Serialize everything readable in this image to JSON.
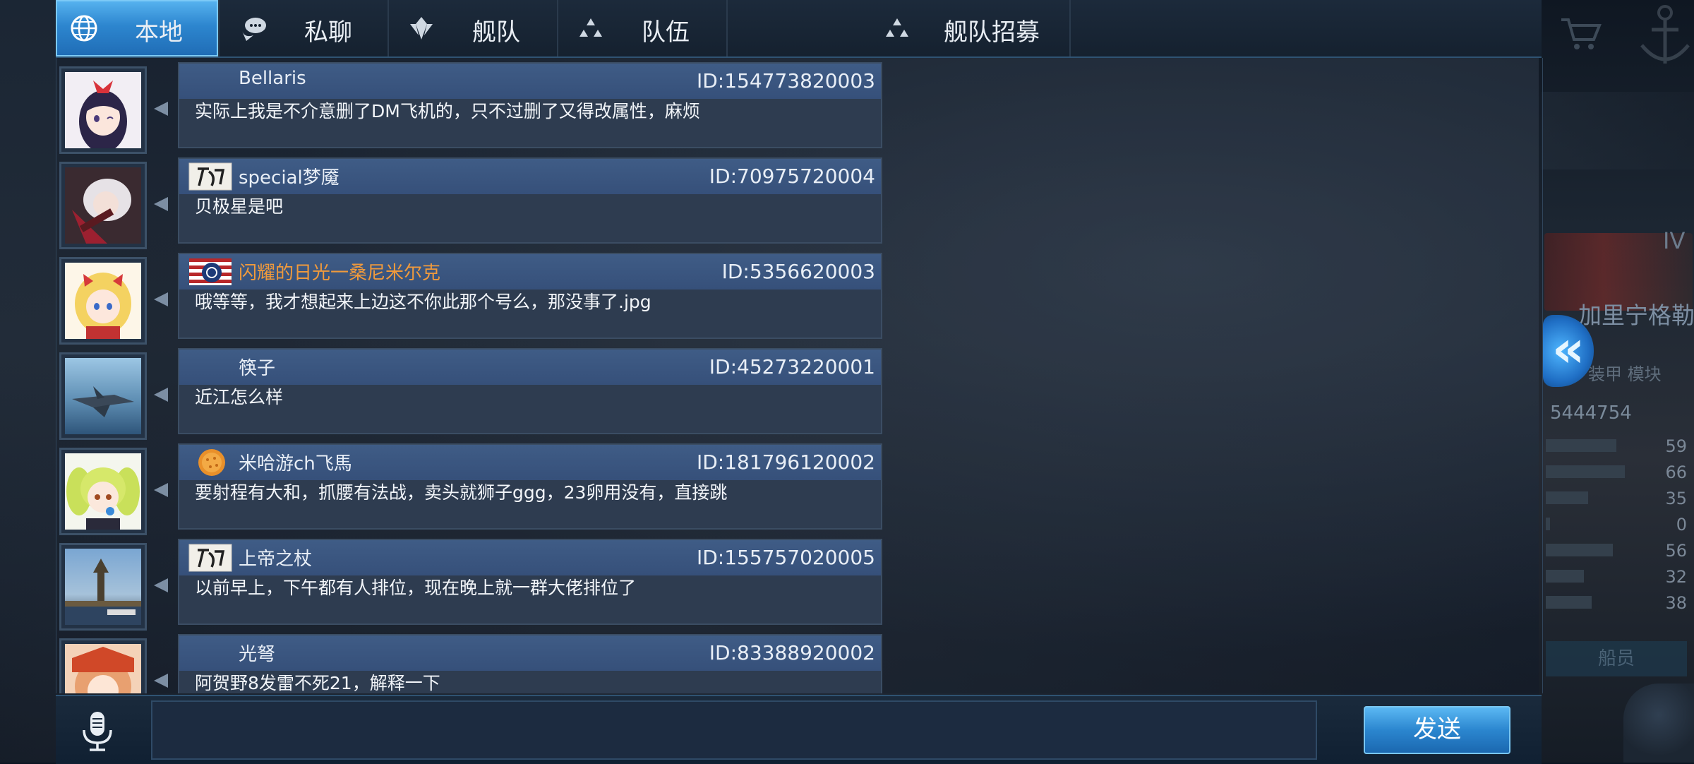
{
  "tabs": [
    {
      "label": "本地",
      "icon": "globe-icon",
      "active": true
    },
    {
      "label": "私聊",
      "icon": "chat-bubble-icon",
      "active": false
    },
    {
      "label": "舰队",
      "icon": "fleet-emblem-icon",
      "active": false
    },
    {
      "label": "队伍",
      "icon": "team-dots-icon",
      "active": false
    },
    {
      "label": "舰队招募",
      "icon": "team-dots-icon",
      "active": false
    }
  ],
  "messages": [
    {
      "name": "Bellaris",
      "id": "ID:154773820003",
      "text": "实际上我是不介意删了DM飞机的，只不过删了又得改属性，麻烦",
      "badge": ""
    },
    {
      "name": "special梦魇",
      "id": "ID:70975720004",
      "text": "贝极星是吧",
      "badge": "calligraphy-badge-icon"
    },
    {
      "name": "闪耀的日光一桑尼米尔克",
      "id": "ID:5356620003",
      "text": "哦等等，我才想起来上边这不你此那个号么，那没事了.jpg",
      "badge": "us-flag-badge-icon"
    },
    {
      "name": "筷子",
      "id": "ID:45273220001",
      "text": "近江怎么样",
      "badge": ""
    },
    {
      "name": "米哈游ch飞馬",
      "id": "ID:181796120002",
      "text": "要射程有大和，抓腰有法战，卖头就狮子ggg，23卵用没有，直接跳",
      "badge": "orange-coin-badge-icon"
    },
    {
      "name": "上帝之杖",
      "id": "ID:155757020005",
      "text": "以前早上，下午都有人排位，现在晚上就一群大佬排位了",
      "badge": "calligraphy-badge-icon"
    },
    {
      "name": "光弩",
      "id": "ID:83388920002",
      "text": "阿贺野8发雷不死21，解释一下",
      "badge": ""
    }
  ],
  "input": {
    "value": "",
    "placeholder": ""
  },
  "send_label": "发送",
  "side": {
    "tier": "IV",
    "ship_name": "加里宁格勒",
    "sub_labels": "装甲  模块",
    "id_text": "5444754",
    "stats": [
      59,
      66,
      35,
      0,
      56,
      32,
      38
    ],
    "crew_label": "船员"
  },
  "colors": {
    "tab_active": "#2d86cf",
    "bubble_header": "#3f5c86",
    "bubble_body": "#2e3c50",
    "highlight_name": "#f09a3c",
    "send_button": "#2b86cf"
  }
}
